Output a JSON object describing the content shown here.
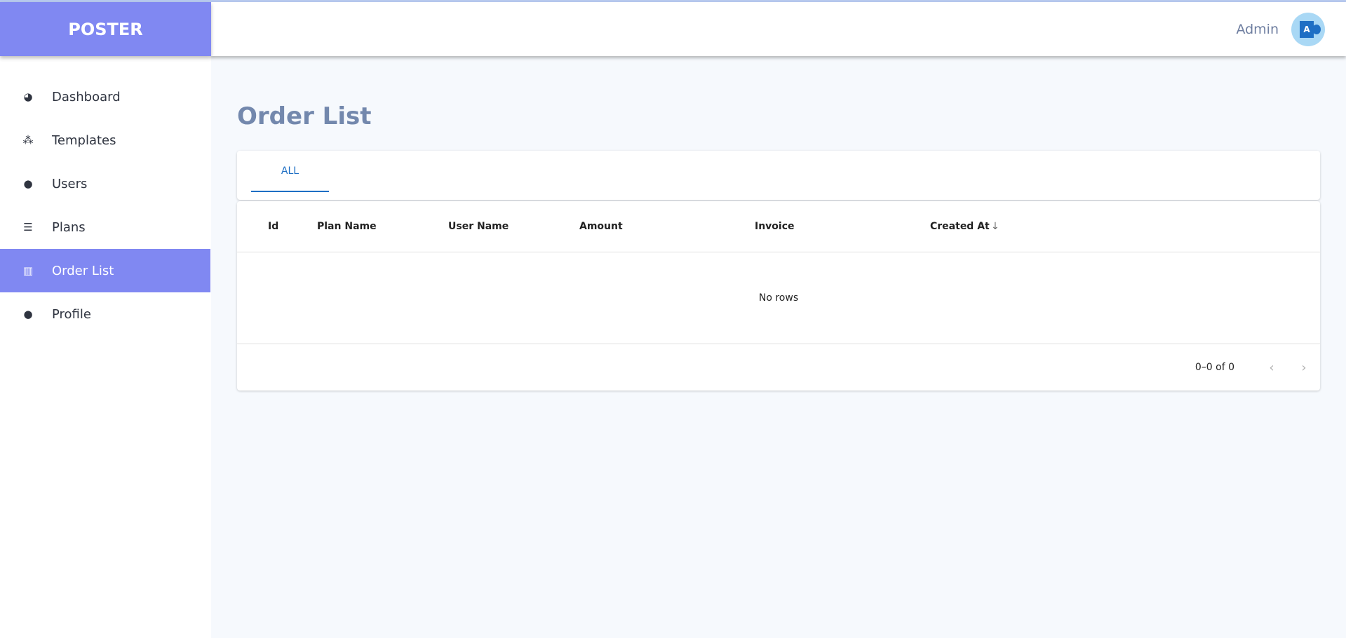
{
  "brand": "POSTER",
  "header": {
    "user": "Admin",
    "avatar_letter": "A"
  },
  "sidebar": {
    "items": [
      {
        "label": "Dashboard",
        "icon": "dashboard-icon"
      },
      {
        "label": "Templates",
        "icon": "cubes-icon"
      },
      {
        "label": "Users",
        "icon": "user-gear-icon"
      },
      {
        "label": "Plans",
        "icon": "list-icon"
      },
      {
        "label": "Order List",
        "icon": "chart-icon",
        "active": true
      },
      {
        "label": "Profile",
        "icon": "user-icon"
      }
    ]
  },
  "page": {
    "title": "Order List",
    "tabs": [
      "ALL"
    ]
  },
  "table": {
    "columns": [
      "Id",
      "Plan Name",
      "User Name",
      "Amount",
      "Invoice",
      "Created At"
    ],
    "sort_icon": "arrow-down-icon",
    "empty": "No rows",
    "pagination": "0–0 of 0"
  },
  "colors": {
    "brand": "#8088f2",
    "accent": "#1e6fc4"
  }
}
